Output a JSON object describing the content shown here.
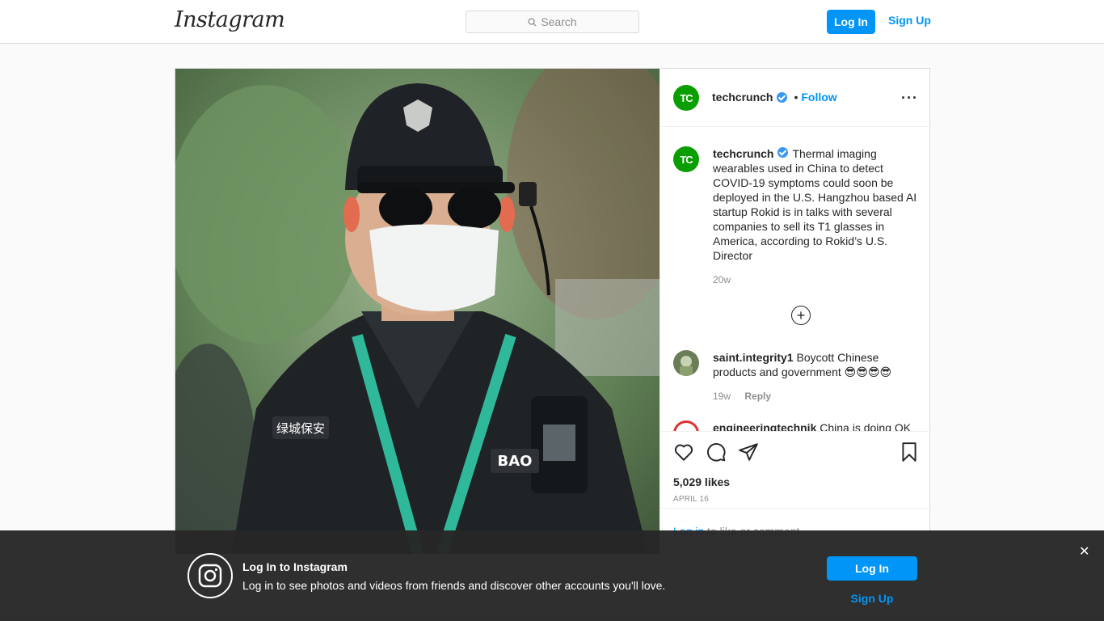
{
  "nav": {
    "logo": "Instagram",
    "search_placeholder": "Search",
    "login_label": "Log In",
    "signup_label": "Sign Up"
  },
  "post": {
    "author": "techcrunch",
    "author_avatar_text": "TC",
    "follow_label": "Follow",
    "separator": "•",
    "caption": "Thermal imaging wearables used in China to detect COVID-19 symptoms could soon be deployed in the U.S. Hangzhou based AI startup Rokid is in talks with several companies to sell its T1 glasses in America, according to Rokid’s U.S. Director",
    "caption_age": "20w",
    "comments": [
      {
        "username": "saint.integrity1",
        "text": "Boycott Chinese products and government 😎😎😎😎",
        "age": "19w",
        "reply_label": "Reply"
      },
      {
        "username": "engineeringtechnik",
        "text": "China is doing OK"
      }
    ],
    "likes": "5,029 likes",
    "date": "APRIL 16",
    "login_prompt_link": "Log in",
    "login_prompt_rest": " to like or comment."
  },
  "banner": {
    "title": "Log In to Instagram",
    "subtitle": "Log in to see photos and videos from friends and discover other accounts you'll love.",
    "login_label": "Log In",
    "signup_label": "Sign Up",
    "close_glyph": "✕"
  },
  "photo": {
    "badge_text": "绿城保安",
    "name_tag_text": "BAO"
  },
  "colors": {
    "accent": "#0095f6",
    "verified": "#3897f0",
    "techcrunch_green": "#0a9e01",
    "banner_bg": "#262626"
  },
  "icons": [
    "search-icon",
    "verified-icon",
    "more-icon",
    "add-comment-icon",
    "heart-icon",
    "comment-icon",
    "share-icon",
    "bookmark-icon",
    "instagram-icon",
    "close-icon"
  ]
}
